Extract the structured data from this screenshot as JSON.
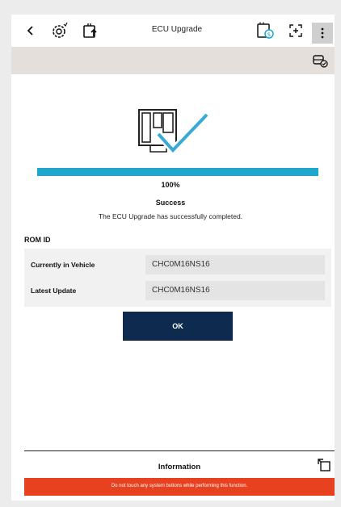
{
  "header": {
    "title": "ECU Upgrade"
  },
  "progress": {
    "percent_value": 1.0,
    "percent_label": "100%",
    "status": "Success",
    "message": "The ECU Upgrade has successfully completed."
  },
  "rom": {
    "section_title": "ROM ID",
    "rows": [
      {
        "label": "Currently in Vehicle",
        "value": "CHC0M16NS16"
      },
      {
        "label": "Latest Update",
        "value": "CHC0M16NS16"
      }
    ]
  },
  "actions": {
    "ok_label": "OK"
  },
  "footer": {
    "info_label": "Information",
    "warning": "Do not touch any system buttons while performing this function."
  },
  "colors": {
    "accent": "#1ea6cc",
    "primary_button": "#0e2a4f",
    "warning": "#e8411f"
  },
  "icons": [
    "back-icon",
    "gear-icon",
    "ecu-upload-icon",
    "storage-icon",
    "capture-icon",
    "more-vertical-icon",
    "car-check-icon",
    "expand-icon"
  ]
}
